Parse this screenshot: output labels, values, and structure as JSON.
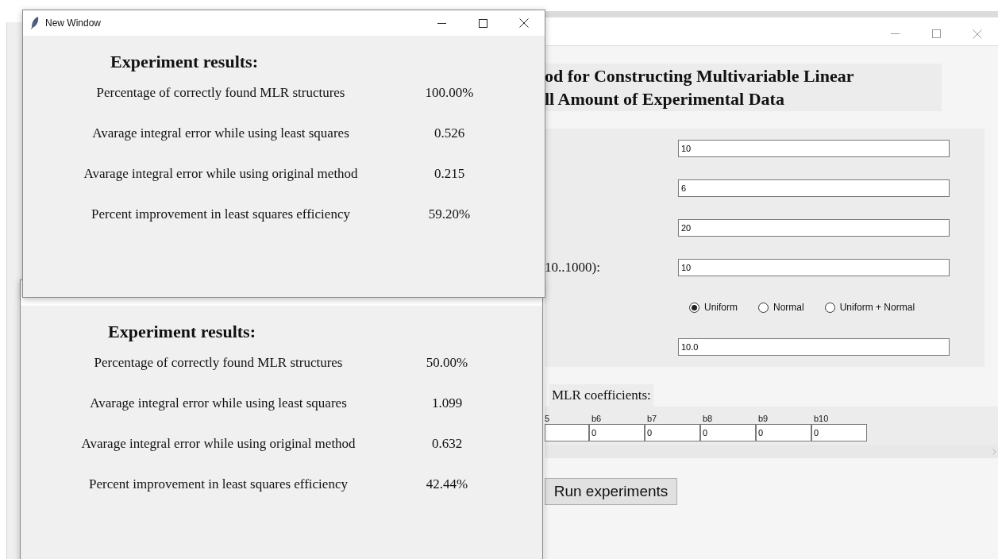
{
  "main_window": {
    "title_lines": [
      "od for Constructing Multivariable Linear",
      "ll Amount of Experimental Data"
    ],
    "form": [
      {
        "kind": "field",
        "value": "10"
      },
      {
        "kind": "field",
        "value": "6"
      },
      {
        "kind": "field",
        "value": "20"
      },
      {
        "kind": "field",
        "label": "10..1000):",
        "value": "10"
      },
      {
        "kind": "radios",
        "options": [
          {
            "label": "Uniform",
            "selected": true
          },
          {
            "label": "Normal",
            "selected": false
          },
          {
            "label": "Uniform + Normal",
            "selected": false
          }
        ]
      },
      {
        "kind": "field",
        "value": "10.0"
      }
    ],
    "coefficients": {
      "label": "MLR coefficients:",
      "items": [
        {
          "name": "5"
        },
        {
          "name": "b6",
          "value": "0"
        },
        {
          "name": "b7",
          "value": "0"
        },
        {
          "name": "b8",
          "value": "0"
        },
        {
          "name": "b9",
          "value": "0"
        },
        {
          "name": "b10",
          "value": "0"
        }
      ]
    },
    "run_button": "Run experiments"
  },
  "result_windows": [
    {
      "title": "New Window",
      "heading": "Experiment results:",
      "rows": [
        {
          "label": "Percentage of correctly found MLR structures",
          "value": "100.00%"
        },
        {
          "label": "Avarage integral error while using least squares",
          "value": "0.526"
        },
        {
          "label": "Avarage integral error while using original method",
          "value": "0.215"
        },
        {
          "label": "Percent improvement in least squares efficiency",
          "value": "59.20%"
        }
      ]
    },
    {
      "heading": "Experiment results:",
      "rows": [
        {
          "label": "Percentage of correctly found MLR structures",
          "value": "50.00%"
        },
        {
          "label": "Avarage integral error while using least squares",
          "value": "1.099"
        },
        {
          "label": "Avarage integral error while using original method",
          "value": "0.632"
        },
        {
          "label": "Percent improvement in least squares efficiency",
          "value": "42.44%"
        }
      ]
    }
  ]
}
